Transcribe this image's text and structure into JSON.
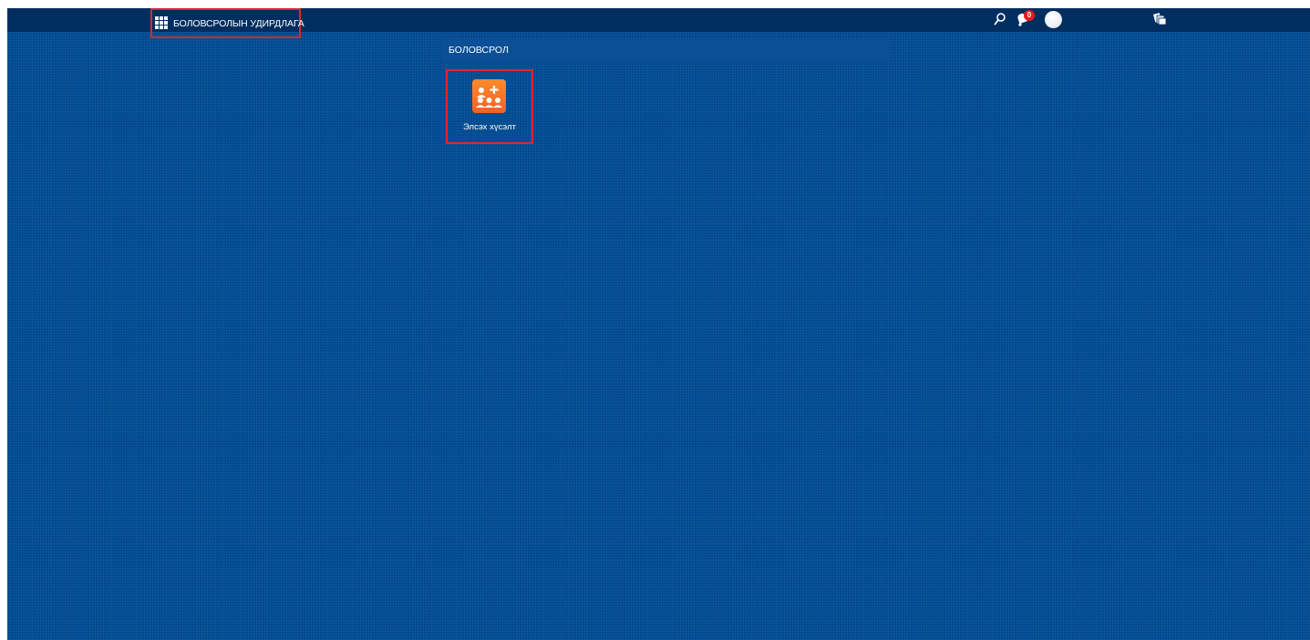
{
  "header": {
    "app_title": "БОЛОВСРОЛЫН УДИРДЛАГА",
    "notification_count": "0"
  },
  "icons": {
    "launcher": "app-grid-icon",
    "search": "search-icon",
    "notifications": "bell-icon",
    "profile": "avatar",
    "tabs": "tabs-icon",
    "tile": "add-group-icon"
  },
  "colors": {
    "background": "#004a8f",
    "topbar": "#002e60",
    "tile_accent": "#f5722a",
    "badge": "#e51d1d",
    "highlight": "#e0262b"
  },
  "section": {
    "title": "БОЛОВСРОЛ",
    "tiles": [
      {
        "label": "Элсэх хүсэлт"
      }
    ]
  }
}
